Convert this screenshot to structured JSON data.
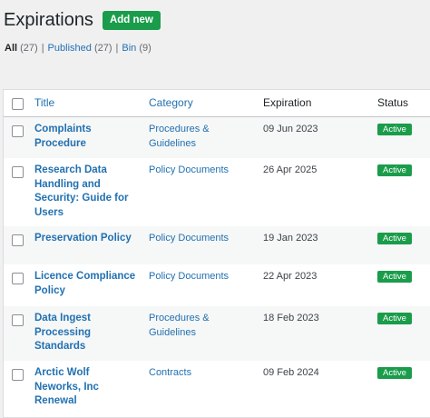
{
  "page": {
    "title": "Expirations",
    "add_new_label": "Add new"
  },
  "filters": {
    "all_label": "All",
    "all_count": "(27)",
    "published_label": "Published",
    "published_count": "(27)",
    "bin_label": "Bin",
    "bin_count": "(9)",
    "separator": "|"
  },
  "table": {
    "columns": {
      "title": "Title",
      "category": "Category",
      "expiration": "Expiration",
      "status": "Status"
    },
    "rows": [
      {
        "title": "Complaints Procedure",
        "category": "Procedures & Guidelines",
        "expiration": "09 Jun 2023",
        "status": "Active"
      },
      {
        "title": "Research Data Handling and Security: Guide for Users",
        "category": "Policy Documents",
        "expiration": "26 Apr 2025",
        "status": "Active"
      },
      {
        "title": "Preservation Policy",
        "category": "Policy Documents",
        "expiration": "19 Jan 2023",
        "status": "Active"
      },
      {
        "title": "Licence Compliance Policy",
        "category": "Policy Documents",
        "expiration": "22 Apr 2023",
        "status": "Active"
      },
      {
        "title": "Data Ingest Processing Standards",
        "category": "Procedures & Guidelines",
        "expiration": "18 Feb 2023",
        "status": "Active"
      },
      {
        "title": "Arctic Wolf Neworks, Inc Renewal",
        "category": "Contracts",
        "expiration": "09 Feb 2024",
        "status": "Active"
      }
    ]
  },
  "colors": {
    "accent_link": "#2271b1",
    "active_badge": "#1a9c4b"
  }
}
